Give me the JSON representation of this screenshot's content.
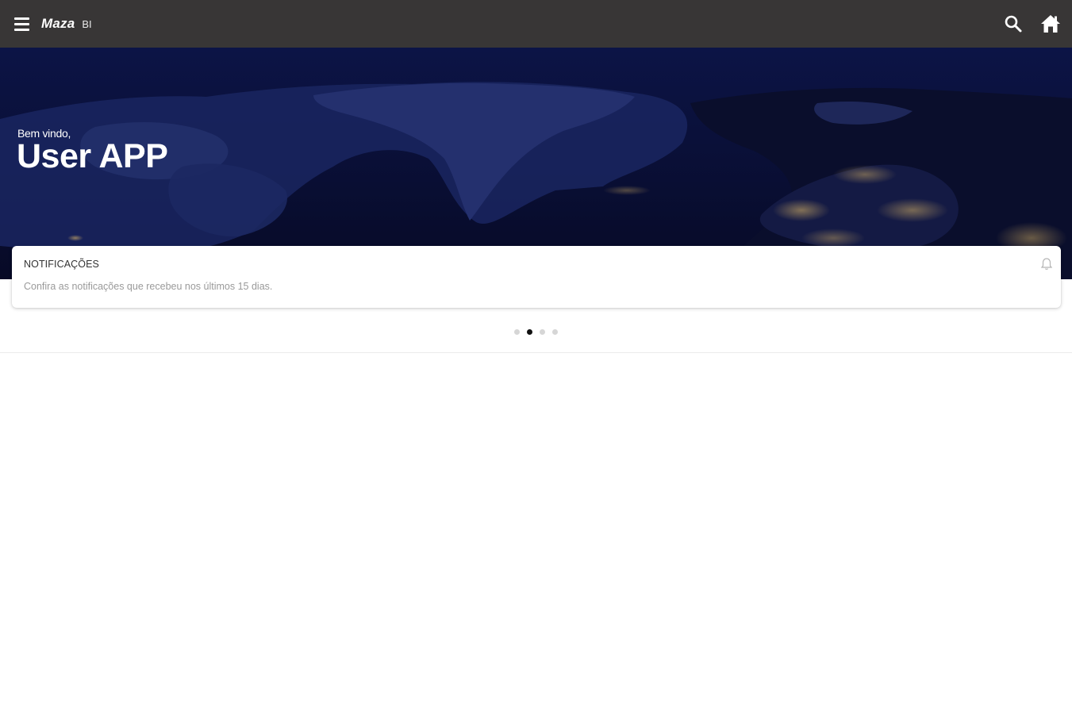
{
  "topbar": {
    "brand_name": "Maza",
    "brand_suffix": "BI",
    "menu_icon": "hamburger-menu-icon",
    "search_icon": "search-icon",
    "home_icon": "home-icon"
  },
  "hero": {
    "greeting": "Bem vindo,",
    "username": "User APP"
  },
  "notification_card": {
    "title": "NOTIFICAÇÕES",
    "description": "Confira as notificações que recebeu nos últimos 15 dias.",
    "icon": "bell-icon"
  },
  "carousel": {
    "total_pages": 4,
    "active_index": 1
  },
  "colors": {
    "topbar": "#383636",
    "hero_background": "#0a0f34",
    "card": "#ffffff",
    "active_dot": "#111111",
    "inactive_dot": "#d6d6d6"
  }
}
